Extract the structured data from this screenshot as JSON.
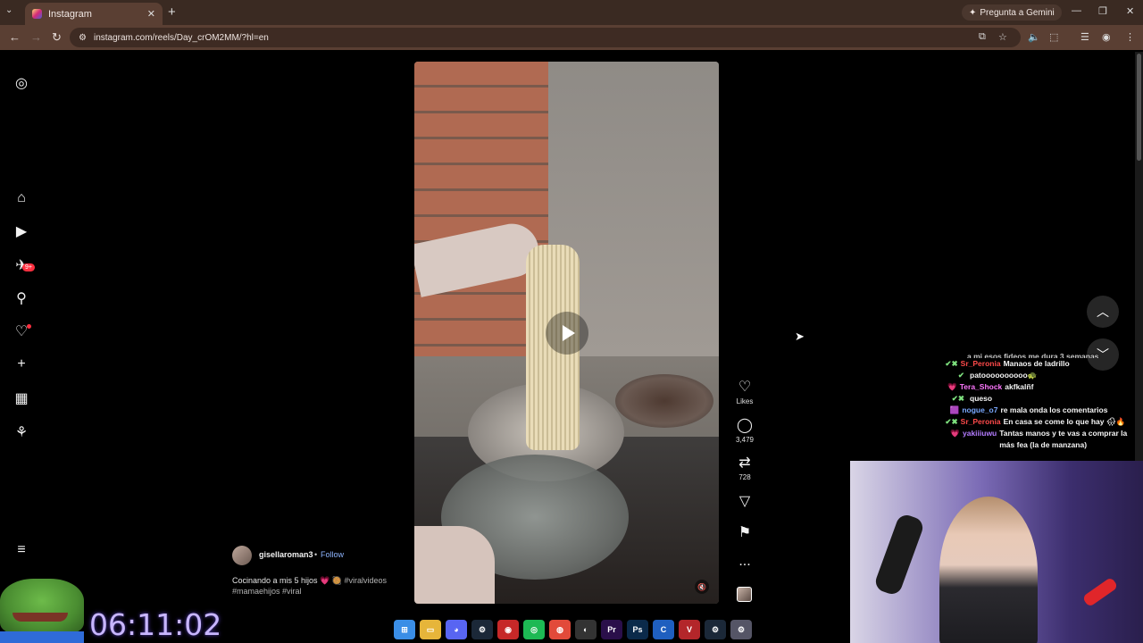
{
  "browser": {
    "tab_title": "Instagram",
    "new_tab": "+",
    "gemini_label": "Pregunta a Gemini",
    "url": "instagram.com/reels/Day_crOM2MM/?hl=en"
  },
  "sidebar": {
    "notifications_badge": "9+"
  },
  "post": {
    "username": "gisellaroman3",
    "separator": "•",
    "follow_label": "Follow",
    "caption_text": "Cocinando a mis 5 hijos 💗 🥘 ",
    "caption_tags_1": "#viralvideos",
    "caption_tags_2": "#mamaehijos #viral"
  },
  "actions": {
    "likes_label": "Likes",
    "comments_count": "3,479",
    "reposts_count": "728",
    "more": "..."
  },
  "chat": [
    {
      "user": "Sr_Peronia",
      "user_color": "#ff4a4a",
      "badges": "✔✖",
      "message": "Manaos de ladrillo"
    },
    {
      "user": "",
      "user_color": "#8a6a4a",
      "badges": "✔",
      "message": "patoooooooooo🐢"
    },
    {
      "user": "Tera_Shock",
      "user_color": "#ff77ff",
      "badges": "💗",
      "message": "akfkalñf"
    },
    {
      "user": "",
      "user_color": "#8a6a4a",
      "badges": "✔✖",
      "message": "queso"
    },
    {
      "user": "nogue_o7",
      "user_color": "#7aa8ff",
      "badges": "🟪",
      "message": "re mala onda los comentarios"
    },
    {
      "user": "Sr_Peronia",
      "user_color": "#ff4a4a",
      "badges": "✔✖",
      "message": "En casa se come lo que hay 🌧🔥"
    },
    {
      "user": "yakiiiuwu",
      "user_color": "#b47cff",
      "badges": "💗",
      "message": "Tantas manos y te vas a comprar la más fea (la de manzana)"
    }
  ],
  "chat_top_partial": "a mi esos fideos me dura 3 semanas",
  "timer": "06:11:02",
  "taskbar": [
    "win",
    "files",
    "discord",
    "steam",
    "app",
    "spotify",
    "chrome",
    "obs",
    "Pr",
    "Ps",
    "C",
    "voice",
    "steam2",
    "settings"
  ]
}
